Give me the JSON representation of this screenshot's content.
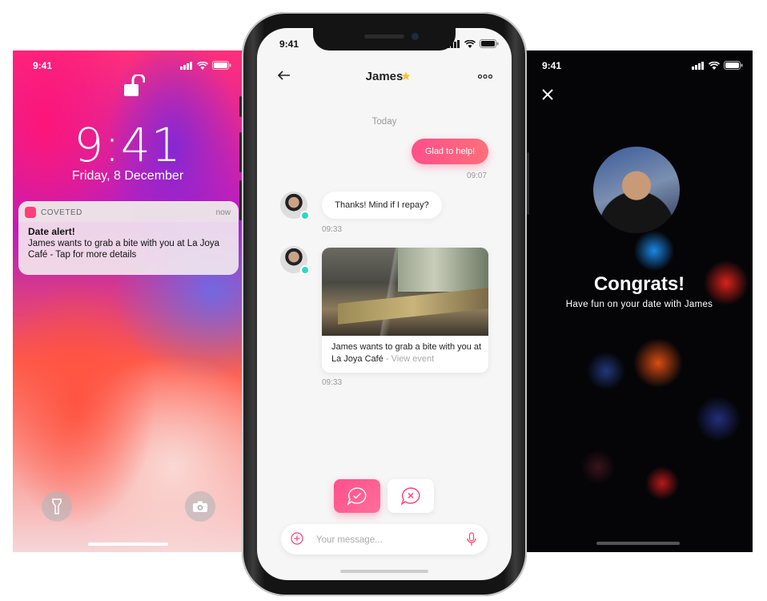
{
  "lock_screen": {
    "status_time": "9:41",
    "clock": "9:41",
    "date": "Friday, 8 December",
    "notification": {
      "app_name": "COVETED",
      "time": "now",
      "title": "Date alert!",
      "body": "James wants to grab a bite with you at La Joya Café - Tap for more details"
    },
    "icons": [
      "unlocked-padlock-icon",
      "flashlight-icon",
      "camera-icon",
      "signal-icon",
      "wifi-icon",
      "battery-icon"
    ]
  },
  "chat_screen": {
    "status_time": "9:41",
    "contact_name": "James",
    "date_divider": "Today",
    "messages": [
      {
        "from": "me",
        "text": "Glad to help!",
        "time": "09:07"
      },
      {
        "from": "them",
        "text": "Thanks! Mind if I repay?",
        "time": "09:33"
      },
      {
        "from": "them",
        "card_text": "James wants to grab a bite with you at La Joya Café",
        "card_separator": " - ",
        "card_link": "View event",
        "time": "09:33"
      }
    ],
    "composer": {
      "placeholder": "Your message..."
    },
    "colors": {
      "accent": "#ff4f8b",
      "online": "#2ed9c0",
      "star": "#f4c430"
    },
    "icons": [
      "back-arrow-icon",
      "star-icon",
      "more-icon",
      "accept-icon",
      "decline-icon",
      "plus-icon",
      "mic-icon"
    ]
  },
  "congrats_screen": {
    "status_time": "9:41",
    "title": "Congrats!",
    "subtitle": "Have fun on your date with James",
    "icons": [
      "close-icon"
    ]
  }
}
